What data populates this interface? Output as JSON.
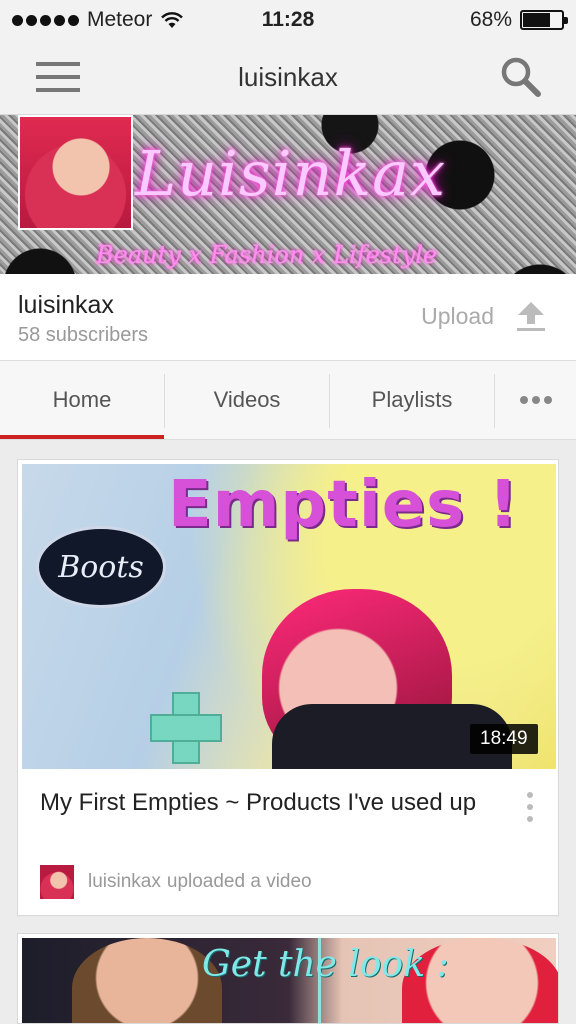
{
  "status_bar": {
    "carrier": "Meteor",
    "time": "11:28",
    "battery_percent": "68%",
    "battery_level": 0.68
  },
  "header": {
    "title": "luisinkax",
    "menu_icon": "hamburger-menu-icon",
    "search_icon": "search-icon"
  },
  "banner": {
    "title": "Luisinkax",
    "tagline": "Beauty x Fashion x Lifestyle"
  },
  "channel": {
    "name": "luisinkax",
    "subscribers": "58 subscribers",
    "upload_label": "Upload",
    "upload_icon": "upload-icon"
  },
  "tabs": [
    {
      "label": "Home",
      "active": true
    },
    {
      "label": "Videos",
      "active": false
    },
    {
      "label": "Playlists",
      "active": false
    }
  ],
  "accent_color": "#cc2222",
  "feed": [
    {
      "thumbnail_text": "Empties !",
      "thumbnail_logo_text": "Boots",
      "duration": "18:49",
      "title": "My First Empties ~ Products I've used up",
      "uploader": "luisinkax",
      "action": "uploaded a video"
    },
    {
      "thumbnail_text": "Get the look :"
    }
  ]
}
